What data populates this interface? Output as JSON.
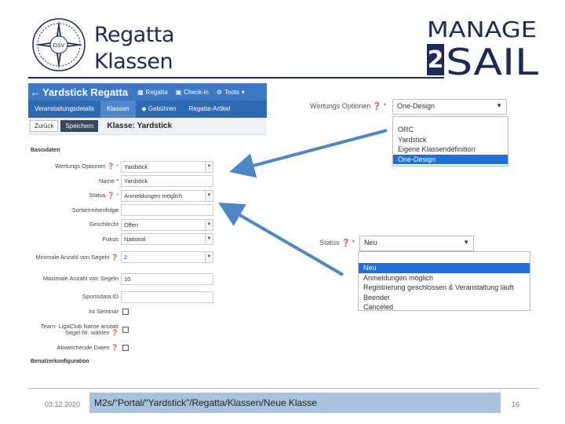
{
  "slide": {
    "title_line1": "Regatta",
    "title_line2": "Klassen",
    "logo_text": "DSV",
    "brand_line1": "MANAGE",
    "brand_digit": "2",
    "brand_line2": "SAIL"
  },
  "app": {
    "back_icon": "arrow-left-icon",
    "title": "Yardstick Regatta",
    "menu": [
      {
        "label": "Regatta",
        "icon": "grid-icon"
      },
      {
        "label": "Check-in",
        "icon": "checkin-icon"
      },
      {
        "label": "Tools",
        "icon": "tools-icon"
      }
    ],
    "tabs": [
      "Veranstaltungsdetails",
      "Klassen",
      "Gebühren",
      "Regatta-Artikel"
    ],
    "active_tab": "Klassen",
    "buttons": {
      "back": "Zurück",
      "save": "Speichern"
    },
    "heading": "Klasse: Yardstick",
    "section": "Basisdaten",
    "fields": [
      {
        "label": "Wertungs Optionen",
        "value": "Yardstick",
        "type": "select",
        "required": true
      },
      {
        "label": "Name *",
        "value": "Yardstick",
        "type": "text"
      },
      {
        "label": "Status",
        "value": "Anmeldungen möglich",
        "type": "select",
        "required": true
      },
      {
        "label": "Sortierreihenfolge",
        "value": "",
        "type": "text"
      },
      {
        "label": "Geschlecht",
        "value": "Offen",
        "type": "select"
      },
      {
        "label": "Fokus",
        "value": "National",
        "type": "select"
      },
      {
        "label": "Minimale Anzahl von Segeln",
        "value": "2",
        "type": "select",
        "help": true
      },
      {
        "label": "Maximale Anzahl von Segeln",
        "value": "10",
        "type": "text"
      },
      {
        "label": "Sportsdata ID",
        "value": "",
        "type": "text"
      },
      {
        "label": "Ist Seminar",
        "type": "checkbox"
      },
      {
        "label": "Team- LigaClub Name anstatt Segel Nr. wählen",
        "type": "checkbox",
        "help": true
      },
      {
        "label": "Abweichende Daten",
        "type": "checkbox",
        "help": true
      }
    ],
    "konfig": "Benutzerkonfiguration"
  },
  "dropdown1": {
    "label": "Wertungs Optionen",
    "selected": "One-Design",
    "options": [
      "ORC",
      "Yardstick",
      "Eigene Klassendefinition",
      "One-Design"
    ],
    "highlight": "One-Design"
  },
  "dropdown2": {
    "label": "Status",
    "selected": "Neu",
    "options": [
      "Neu",
      "Anmeldungen möglich",
      "Registrierung geschlossen & Veranstaltung läuft",
      "Beendet",
      "Canceled"
    ],
    "highlight": "Neu"
  },
  "footer": {
    "date": "03.12.2020",
    "path": "M2s/“Portal/“Yardstick”/Regatta/Klassen/Neue Klasse",
    "page": "16"
  },
  "colors": {
    "navy": "#1b2a57",
    "appblue": "#3c78c3",
    "highlight": "#1e6fd9",
    "arrow": "#4b86c6"
  }
}
